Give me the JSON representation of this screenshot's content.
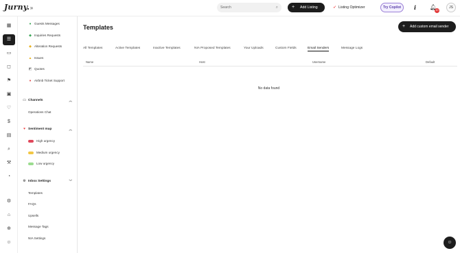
{
  "app": {
    "logo": "Jurny.",
    "collapse_icon": "»"
  },
  "topbar": {
    "search": {
      "placeholder": "Search",
      "icon": "search-icon"
    },
    "add_listing": "Add Listing",
    "listing_optimizer": "Listing Optimizer",
    "copilot": "Try Copilot",
    "notifications_count": "10",
    "avatar_initials": "JS"
  },
  "rail": [
    {
      "name": "dashboard-icon",
      "glyph": "▦"
    },
    {
      "name": "inbox-icon",
      "glyph": "☰",
      "active": true
    },
    {
      "name": "calendar-icon",
      "glyph": "▭"
    },
    {
      "name": "bag-icon",
      "glyph": "◻"
    },
    {
      "name": "flag-icon",
      "glyph": "⚑"
    },
    {
      "name": "box-icon",
      "glyph": "▣"
    },
    {
      "name": "heart-icon",
      "glyph": "♡"
    },
    {
      "name": "dollar-icon",
      "glyph": "$"
    },
    {
      "name": "receipt-icon",
      "glyph": "▤"
    },
    {
      "name": "search-icon",
      "glyph": "⌕"
    },
    {
      "name": "wrench-icon",
      "glyph": "⚒"
    },
    {
      "name": "analytics-icon",
      "glyph": "◔"
    },
    {
      "name": "settings-icon",
      "glyph": "⚙"
    },
    {
      "name": "home-icon",
      "glyph": "⌂"
    },
    {
      "name": "search-user-icon",
      "glyph": "⊕"
    },
    {
      "name": "bot-icon",
      "glyph": "☺"
    }
  ],
  "sidebar": {
    "top_items": [
      {
        "label": "Guests Messages",
        "color": "#3aa655",
        "glyph": "●"
      },
      {
        "label": "Inquiries Requests",
        "color": "#3aa655",
        "glyph": "◆"
      },
      {
        "label": "Alteration Requests",
        "color": "#e8b21e",
        "glyph": "◆"
      },
      {
        "label": "Issues",
        "color": "#e8b21e",
        "glyph": "▲"
      },
      {
        "label": "Quotes",
        "color": "#888888",
        "glyph": "◩"
      },
      {
        "label": "Airbnb Ticket Support",
        "color": "#e05555",
        "glyph": "●"
      }
    ],
    "channels": {
      "title": "Channels",
      "items": [
        "Operations Chat"
      ]
    },
    "sentiment": {
      "title": "Sentiment map",
      "items": [
        {
          "label": "High urgency",
          "color": "#e0475b"
        },
        {
          "label": "Medium urgency",
          "color": "#f2c744"
        },
        {
          "label": "Low urgency",
          "color": "#9bdc8f"
        }
      ]
    },
    "inbox_settings": {
      "title": "Inbox Settings",
      "items": [
        "Templates",
        "FAQs",
        "Upsells",
        "Message Tags",
        "NIA Settings"
      ]
    }
  },
  "main": {
    "title": "Templates",
    "add_button": "Add custom email sender",
    "tabs": [
      "All Templates",
      "Active Templates",
      "Inactive Templates",
      "NIA Proposed Templates",
      "Your Uploads",
      "Custom Fields",
      "Email Senders",
      "Message Logs"
    ],
    "active_tab": "Email Senders",
    "columns": [
      "Name",
      "Host",
      "Username",
      "Default"
    ],
    "empty_text": "No data found"
  }
}
